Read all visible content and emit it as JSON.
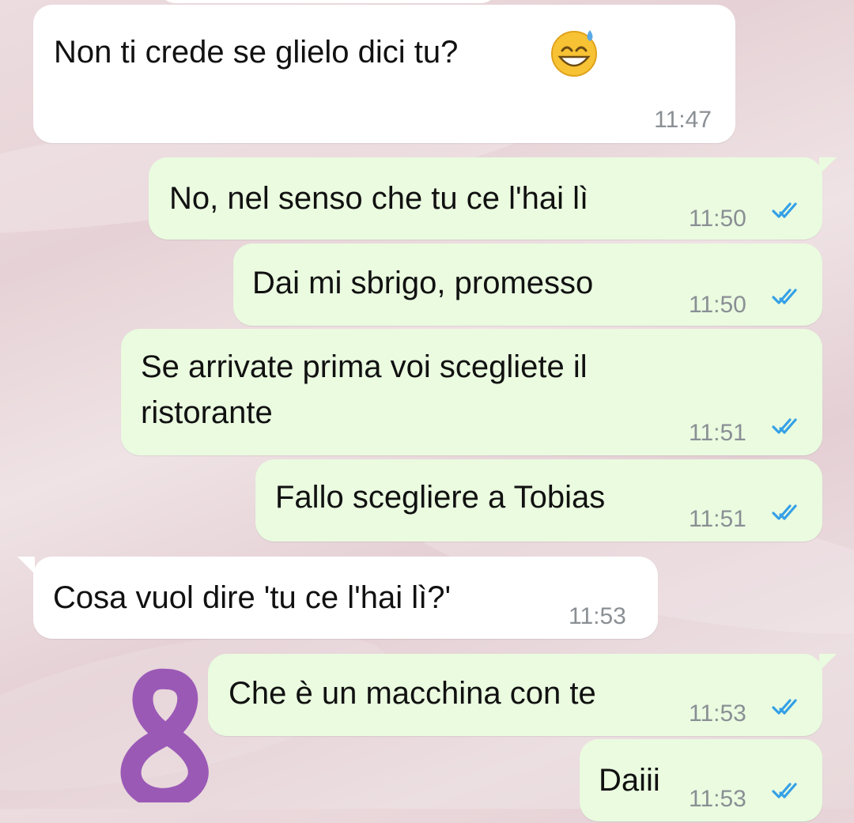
{
  "chat": {
    "messages": [
      {
        "direction": "incoming",
        "text": "Non ti crede se glielo dici tu?",
        "emoji": "sweat-smile-emoji",
        "time": "11:47"
      },
      {
        "direction": "outgoing",
        "text": "No, nel senso che tu ce l'hai lì",
        "time": "11:50",
        "status": "read"
      },
      {
        "direction": "outgoing",
        "text": "Dai mi sbrigo, promesso",
        "time": "11:50",
        "status": "read"
      },
      {
        "direction": "outgoing",
        "text_line1": "Se arrivate prima voi scegliete il",
        "text_line2": "ristorante",
        "time": "11:51",
        "status": "read"
      },
      {
        "direction": "outgoing",
        "text": "Fallo scegliere a Tobias",
        "time": "11:51",
        "status": "read"
      },
      {
        "direction": "incoming",
        "text": "Cosa vuol dire 'tu ce l'hai lì?'",
        "time": "11:53"
      },
      {
        "direction": "outgoing",
        "text": "Che è un macchina con te",
        "time": "11:53",
        "status": "read"
      },
      {
        "direction": "outgoing",
        "text": "Daiii",
        "time": "11:53",
        "status": "read"
      }
    ]
  },
  "colors": {
    "incoming_bubble": "#ffffff",
    "outgoing_bubble": "#eafbe0",
    "read_ticks": "#34a0e6",
    "doodle": "#9b59b6"
  },
  "icons": [
    "double-check-icon",
    "sweat-smile-emoji",
    "purple-doodle"
  ]
}
